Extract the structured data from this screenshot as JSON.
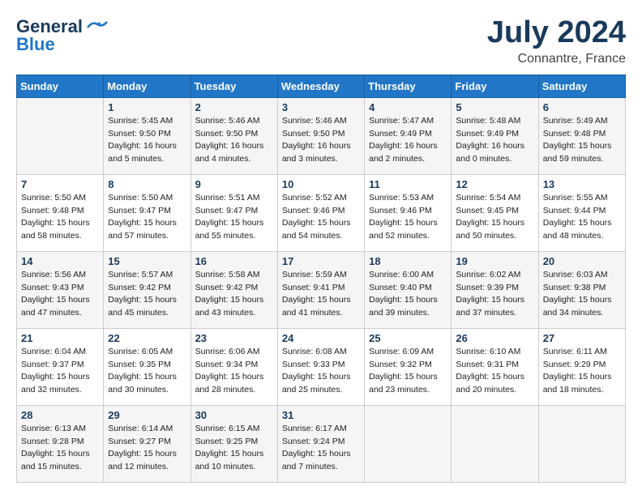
{
  "header": {
    "logo_line1": "General",
    "logo_line2": "Blue",
    "month": "July 2024",
    "location": "Connantre, France"
  },
  "days_of_week": [
    "Sunday",
    "Monday",
    "Tuesday",
    "Wednesday",
    "Thursday",
    "Friday",
    "Saturday"
  ],
  "weeks": [
    [
      {
        "day": "",
        "info": ""
      },
      {
        "day": "1",
        "info": "Sunrise: 5:45 AM\nSunset: 9:50 PM\nDaylight: 16 hours\nand 5 minutes."
      },
      {
        "day": "2",
        "info": "Sunrise: 5:46 AM\nSunset: 9:50 PM\nDaylight: 16 hours\nand 4 minutes."
      },
      {
        "day": "3",
        "info": "Sunrise: 5:46 AM\nSunset: 9:50 PM\nDaylight: 16 hours\nand 3 minutes."
      },
      {
        "day": "4",
        "info": "Sunrise: 5:47 AM\nSunset: 9:49 PM\nDaylight: 16 hours\nand 2 minutes."
      },
      {
        "day": "5",
        "info": "Sunrise: 5:48 AM\nSunset: 9:49 PM\nDaylight: 16 hours\nand 0 minutes."
      },
      {
        "day": "6",
        "info": "Sunrise: 5:49 AM\nSunset: 9:48 PM\nDaylight: 15 hours\nand 59 minutes."
      }
    ],
    [
      {
        "day": "7",
        "info": "Sunrise: 5:50 AM\nSunset: 9:48 PM\nDaylight: 15 hours\nand 58 minutes."
      },
      {
        "day": "8",
        "info": "Sunrise: 5:50 AM\nSunset: 9:47 PM\nDaylight: 15 hours\nand 57 minutes."
      },
      {
        "day": "9",
        "info": "Sunrise: 5:51 AM\nSunset: 9:47 PM\nDaylight: 15 hours\nand 55 minutes."
      },
      {
        "day": "10",
        "info": "Sunrise: 5:52 AM\nSunset: 9:46 PM\nDaylight: 15 hours\nand 54 minutes."
      },
      {
        "day": "11",
        "info": "Sunrise: 5:53 AM\nSunset: 9:46 PM\nDaylight: 15 hours\nand 52 minutes."
      },
      {
        "day": "12",
        "info": "Sunrise: 5:54 AM\nSunset: 9:45 PM\nDaylight: 15 hours\nand 50 minutes."
      },
      {
        "day": "13",
        "info": "Sunrise: 5:55 AM\nSunset: 9:44 PM\nDaylight: 15 hours\nand 48 minutes."
      }
    ],
    [
      {
        "day": "14",
        "info": "Sunrise: 5:56 AM\nSunset: 9:43 PM\nDaylight: 15 hours\nand 47 minutes."
      },
      {
        "day": "15",
        "info": "Sunrise: 5:57 AM\nSunset: 9:42 PM\nDaylight: 15 hours\nand 45 minutes."
      },
      {
        "day": "16",
        "info": "Sunrise: 5:58 AM\nSunset: 9:42 PM\nDaylight: 15 hours\nand 43 minutes."
      },
      {
        "day": "17",
        "info": "Sunrise: 5:59 AM\nSunset: 9:41 PM\nDaylight: 15 hours\nand 41 minutes."
      },
      {
        "day": "18",
        "info": "Sunrise: 6:00 AM\nSunset: 9:40 PM\nDaylight: 15 hours\nand 39 minutes."
      },
      {
        "day": "19",
        "info": "Sunrise: 6:02 AM\nSunset: 9:39 PM\nDaylight: 15 hours\nand 37 minutes."
      },
      {
        "day": "20",
        "info": "Sunrise: 6:03 AM\nSunset: 9:38 PM\nDaylight: 15 hours\nand 34 minutes."
      }
    ],
    [
      {
        "day": "21",
        "info": "Sunrise: 6:04 AM\nSunset: 9:37 PM\nDaylight: 15 hours\nand 32 minutes."
      },
      {
        "day": "22",
        "info": "Sunrise: 6:05 AM\nSunset: 9:35 PM\nDaylight: 15 hours\nand 30 minutes."
      },
      {
        "day": "23",
        "info": "Sunrise: 6:06 AM\nSunset: 9:34 PM\nDaylight: 15 hours\nand 28 minutes."
      },
      {
        "day": "24",
        "info": "Sunrise: 6:08 AM\nSunset: 9:33 PM\nDaylight: 15 hours\nand 25 minutes."
      },
      {
        "day": "25",
        "info": "Sunrise: 6:09 AM\nSunset: 9:32 PM\nDaylight: 15 hours\nand 23 minutes."
      },
      {
        "day": "26",
        "info": "Sunrise: 6:10 AM\nSunset: 9:31 PM\nDaylight: 15 hours\nand 20 minutes."
      },
      {
        "day": "27",
        "info": "Sunrise: 6:11 AM\nSunset: 9:29 PM\nDaylight: 15 hours\nand 18 minutes."
      }
    ],
    [
      {
        "day": "28",
        "info": "Sunrise: 6:13 AM\nSunset: 9:28 PM\nDaylight: 15 hours\nand 15 minutes."
      },
      {
        "day": "29",
        "info": "Sunrise: 6:14 AM\nSunset: 9:27 PM\nDaylight: 15 hours\nand 12 minutes."
      },
      {
        "day": "30",
        "info": "Sunrise: 6:15 AM\nSunset: 9:25 PM\nDaylight: 15 hours\nand 10 minutes."
      },
      {
        "day": "31",
        "info": "Sunrise: 6:17 AM\nSunset: 9:24 PM\nDaylight: 15 hours\nand 7 minutes."
      },
      {
        "day": "",
        "info": ""
      },
      {
        "day": "",
        "info": ""
      },
      {
        "day": "",
        "info": ""
      }
    ]
  ]
}
